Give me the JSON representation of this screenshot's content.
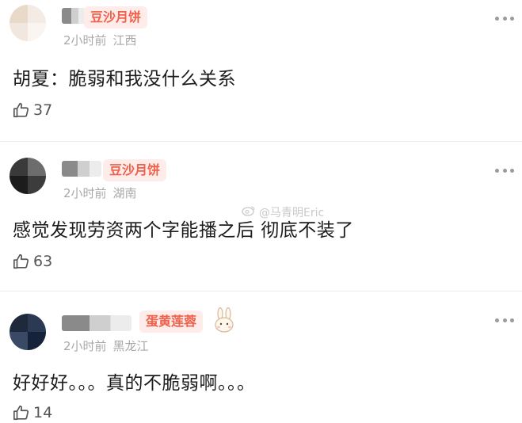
{
  "colors": {
    "badge_bg": "#fdecea",
    "badge_text": "#f0604a",
    "meta": "#a8a8a8"
  },
  "watermark": {
    "text": "@马青明Eric",
    "icon": "weibo-logo-icon"
  },
  "comments": [
    {
      "badge": "豆沙月饼",
      "time": "2小时前",
      "location": "江西",
      "text": "胡夏：脆弱和我没什么关系",
      "likes": "37",
      "avatar": "blurred-avatar",
      "like_icon": "thumbs-up-icon",
      "more_icon": "more-dots-icon"
    },
    {
      "badge": "豆沙月饼",
      "time": "2小时前",
      "location": "湖南",
      "text": "感觉发现劳资两个字能播之后 彻底不装了",
      "likes": "63",
      "avatar": "blurred-avatar",
      "like_icon": "thumbs-up-icon",
      "more_icon": "more-dots-icon"
    },
    {
      "badge": "蛋黄莲蓉",
      "badge_icon": "bunny-icon",
      "time": "2小时前",
      "location": "黑龙江",
      "text": "好好好。。。真的不脆弱啊。。。",
      "likes": "14",
      "avatar": "blurred-avatar",
      "like_icon": "thumbs-up-icon",
      "more_icon": "more-dots-icon"
    }
  ]
}
